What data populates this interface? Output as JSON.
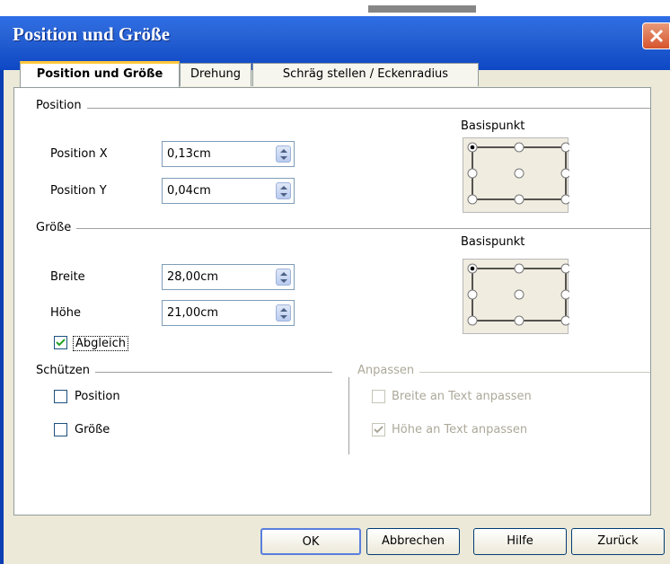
{
  "window": {
    "title": "Position und Größe"
  },
  "tabs": [
    "Position und Größe",
    "Drehung",
    "Schräg stellen / Eckenradius"
  ],
  "position_group": {
    "title": "Position",
    "x_label": "Position X",
    "x_value": "0,13cm",
    "y_label": "Position Y",
    "y_value": "0,04cm",
    "basis_label": "Basispunkt"
  },
  "size_group": {
    "title": "Größe",
    "width_label": "Breite",
    "width_value": "28,00cm",
    "height_label": "Höhe",
    "height_value": "21,00cm",
    "basis_label": "Basispunkt",
    "keep_ratio_label": "Abgleich",
    "keep_ratio_checked": true
  },
  "protect_group": {
    "title": "Schützen",
    "position_label": "Position",
    "size_label": "Größe"
  },
  "fit_group": {
    "title": "Anpassen",
    "fit_width_label": "Breite an Text anpassen",
    "fit_height_label": "Höhe an Text anpassen",
    "fit_height_checked": true
  },
  "buttons": {
    "ok": "OK",
    "cancel": "Abbrechen",
    "help": "Hilfe",
    "reset": "Zurück"
  }
}
